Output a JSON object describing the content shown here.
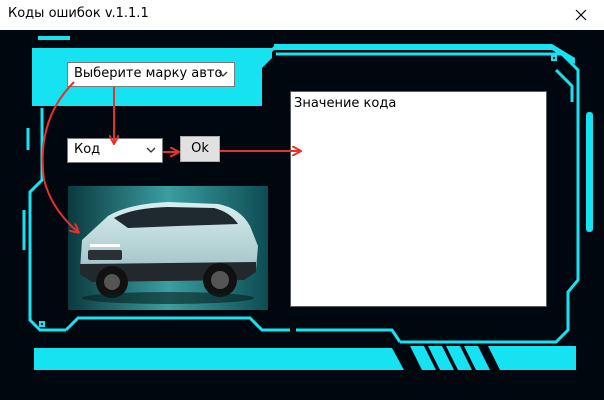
{
  "window": {
    "title": "Коды ошибок v.1.1.1",
    "close_glyph": "✕"
  },
  "brand_select": {
    "value": "Выберите марку авто"
  },
  "code_select": {
    "value": "Код"
  },
  "ok_button": {
    "label": "Ok"
  },
  "code_output": {
    "text": "Значение кода"
  },
  "icons": {
    "close": "close-icon",
    "chevron": "chevron-down-icon"
  },
  "colors": {
    "frame_cyan": "#16e3f2",
    "background": "#00070f",
    "arrow_red": "#e8312c",
    "button_gray": "#e1e1e1"
  }
}
